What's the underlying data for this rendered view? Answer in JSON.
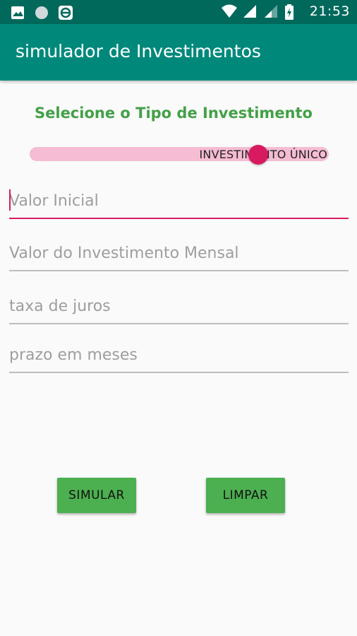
{
  "status_bar": {
    "time": "21:53",
    "icons": [
      "image-icon",
      "circle-icon",
      "e-app-icon",
      "wifi-icon",
      "signal-icon",
      "signal-weak-icon",
      "battery-charging-icon"
    ]
  },
  "app_bar": {
    "title": "simulador de Investimentos",
    "color": "#00897b",
    "status_color": "#00695c"
  },
  "form": {
    "section_title": "Selecione o Tipo de Investimento",
    "section_title_color": "#43a047",
    "investment_type_switch": {
      "label": "INVESTIMENTO ÚNICO",
      "checked": true,
      "thumb_color": "#d81b60",
      "track_color": "#f5bcd3"
    },
    "fields": {
      "initial_value": {
        "placeholder": "Valor Inicial",
        "value": "",
        "focused": true
      },
      "monthly_value": {
        "placeholder": "Valor do Investimento Mensal",
        "value": ""
      },
      "interest_rate": {
        "placeholder": "taxa de juros",
        "value": ""
      },
      "term_months": {
        "placeholder": "prazo em meses",
        "value": ""
      }
    },
    "buttons": {
      "simulate": "SIMULAR",
      "clear": "LIMPAR",
      "color": "#4caf50"
    }
  }
}
